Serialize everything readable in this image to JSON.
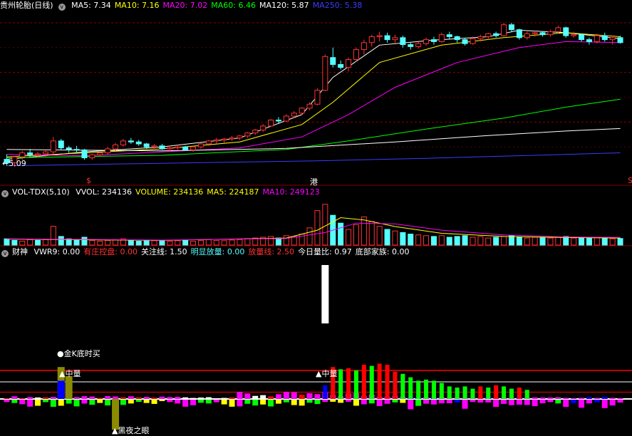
{
  "colors": {
    "ma5": "#ffffff",
    "ma10": "#ffff00",
    "ma20": "#ff00ff",
    "ma60": "#00ff00",
    "ma120": "#ffffff",
    "ma250": "#3b3bff",
    "up": "#ff3232",
    "down": "#54ffff",
    "red": "#ff0000",
    "green": "#00ff00",
    "magenta": "#ff00ff",
    "blue": "#0000ff",
    "olive": "#8b8b00",
    "white": "#ffffff"
  },
  "price_panel": {
    "title": "贵州轮胎(日线)",
    "indicators": [
      {
        "label": "MA5: 7.34",
        "color": "#ffffff"
      },
      {
        "label": "MA10: 7.16",
        "color": "#ffff00"
      },
      {
        "label": "MA20: 7.02",
        "color": "#ff00ff"
      },
      {
        "label": "MA60: 6.46",
        "color": "#00ff00"
      },
      {
        "label": "MA120: 5.87",
        "color": "#ffffff"
      },
      {
        "label": "MA250: 5.38",
        "color": "#3b3bff"
      }
    ],
    "low_label": "←5.09",
    "markers": [
      {
        "text": "$",
        "color": "#ff3232"
      },
      {
        "text": "港",
        "color": "#ffffff"
      },
      {
        "text": "S",
        "color": "#ff3232"
      }
    ]
  },
  "volume_panel": {
    "title": "VOL-TDX(5,10)",
    "indicators": [
      {
        "label": "VVOL: 234136",
        "color": "#ffffff"
      },
      {
        "label": "VOLUME: 234136",
        "color": "#ffff00"
      },
      {
        "label": "MA5: 224187",
        "color": "#ffff00"
      },
      {
        "label": "MA10: 249123",
        "color": "#ff00ff"
      }
    ]
  },
  "indicator_panel": {
    "title": "财神",
    "indicators": [
      {
        "label": "VWR9: 0.00",
        "color": "#ffffff"
      },
      {
        "label": "有庄控盘: 0.00",
        "color": "#ff3232"
      },
      {
        "label": "关注线: 1.50",
        "color": "#ffffff"
      },
      {
        "label": "明显放量: 0.00",
        "color": "#54ffff"
      },
      {
        "label": "放量线: 2.50",
        "color": "#ff3232"
      },
      {
        "label": "今日量比: 0.97",
        "color": "#ffffff"
      },
      {
        "label": "底部家族: 0.00",
        "color": "#ffffff"
      }
    ],
    "annotations": {
      "golden": "●金K底时买",
      "mid1": "▲中量",
      "mid2": "▲中量",
      "dark": "▲黑夜之眼"
    }
  },
  "chart_data": [
    {
      "type": "candlestick",
      "panel": "price",
      "y_range": [
        4.9,
        8.2
      ],
      "candles": [
        [
          5.25,
          5.35,
          5.12,
          5.18
        ],
        [
          5.18,
          5.32,
          5.1,
          5.3
        ],
        [
          5.3,
          5.42,
          5.24,
          5.38
        ],
        [
          5.38,
          5.46,
          5.3,
          5.34
        ],
        [
          5.34,
          5.4,
          5.28,
          5.36
        ],
        [
          5.36,
          5.44,
          5.3,
          5.4
        ],
        [
          5.4,
          5.7,
          5.36,
          5.62
        ],
        [
          5.62,
          5.66,
          5.44,
          5.48
        ],
        [
          5.48,
          5.52,
          5.38,
          5.45
        ],
        [
          5.45,
          5.52,
          5.38,
          5.44
        ],
        [
          5.44,
          5.46,
          5.24,
          5.28
        ],
        [
          5.28,
          5.36,
          5.24,
          5.34
        ],
        [
          5.34,
          5.4,
          5.3,
          5.38
        ],
        [
          5.38,
          5.5,
          5.35,
          5.46
        ],
        [
          5.46,
          5.58,
          5.42,
          5.54
        ],
        [
          5.54,
          5.66,
          5.5,
          5.62
        ],
        [
          5.62,
          5.68,
          5.56,
          5.6
        ],
        [
          5.6,
          5.64,
          5.52,
          5.56
        ],
        [
          5.56,
          5.58,
          5.46,
          5.5
        ],
        [
          5.5,
          5.56,
          5.44,
          5.52
        ],
        [
          5.52,
          5.56,
          5.44,
          5.46
        ],
        [
          5.46,
          5.52,
          5.4,
          5.48
        ],
        [
          5.48,
          5.54,
          5.44,
          5.5
        ],
        [
          5.5,
          5.52,
          5.42,
          5.44
        ],
        [
          5.44,
          5.52,
          5.4,
          5.5
        ],
        [
          5.5,
          5.58,
          5.46,
          5.56
        ],
        [
          5.56,
          5.64,
          5.52,
          5.62
        ],
        [
          5.62,
          5.68,
          5.56,
          5.64
        ],
        [
          5.64,
          5.68,
          5.58,
          5.66
        ],
        [
          5.66,
          5.72,
          5.62,
          5.68
        ],
        [
          5.68,
          5.74,
          5.64,
          5.72
        ],
        [
          5.72,
          5.8,
          5.68,
          5.78
        ],
        [
          5.78,
          5.86,
          5.74,
          5.84
        ],
        [
          5.84,
          5.96,
          5.8,
          5.92
        ],
        [
          5.92,
          6.06,
          5.9,
          6.04
        ],
        [
          6.04,
          6.1,
          5.96,
          6.02
        ],
        [
          6.02,
          6.16,
          6.0,
          6.12
        ],
        [
          6.12,
          6.22,
          6.08,
          6.18
        ],
        [
          6.18,
          6.3,
          6.14,
          6.28
        ],
        [
          6.28,
          6.4,
          6.24,
          6.36
        ],
        [
          6.36,
          6.68,
          6.34,
          6.64
        ],
        [
          6.64,
          7.36,
          6.62,
          7.32
        ],
        [
          7.3,
          7.5,
          7.1,
          7.16
        ],
        [
          7.16,
          7.24,
          7.06,
          7.1
        ],
        [
          7.1,
          7.3,
          7.02,
          7.26
        ],
        [
          7.26,
          7.5,
          7.22,
          7.46
        ],
        [
          7.46,
          7.66,
          7.36,
          7.6
        ],
        [
          7.6,
          7.76,
          7.52,
          7.72
        ],
        [
          7.72,
          7.82,
          7.62,
          7.74
        ],
        [
          7.74,
          7.8,
          7.6,
          7.66
        ],
        [
          7.66,
          7.76,
          7.58,
          7.7
        ],
        [
          7.7,
          7.74,
          7.5,
          7.56
        ],
        [
          7.56,
          7.6,
          7.46,
          7.52
        ],
        [
          7.52,
          7.62,
          7.48,
          7.58
        ],
        [
          7.58,
          7.7,
          7.54,
          7.66
        ],
        [
          7.66,
          7.72,
          7.56,
          7.62
        ],
        [
          7.62,
          7.8,
          7.6,
          7.76
        ],
        [
          7.76,
          7.82,
          7.66,
          7.72
        ],
        [
          7.72,
          7.74,
          7.6,
          7.66
        ],
        [
          7.66,
          7.7,
          7.54,
          7.58
        ],
        [
          7.58,
          7.72,
          7.56,
          7.68
        ],
        [
          7.68,
          7.76,
          7.62,
          7.72
        ],
        [
          7.72,
          7.8,
          7.66,
          7.78
        ],
        [
          7.78,
          7.82,
          7.7,
          7.74
        ],
        [
          7.74,
          8.0,
          7.72,
          7.96
        ],
        [
          7.96,
          8.0,
          7.82,
          7.86
        ],
        [
          7.86,
          7.88,
          7.66,
          7.7
        ],
        [
          7.7,
          7.82,
          7.66,
          7.78
        ],
        [
          7.78,
          7.84,
          7.72,
          7.8
        ],
        [
          7.8,
          7.82,
          7.72,
          7.76
        ],
        [
          7.76,
          7.86,
          7.72,
          7.82
        ],
        [
          7.82,
          7.94,
          7.78,
          7.9
        ],
        [
          7.9,
          7.92,
          7.7,
          7.74
        ],
        [
          7.74,
          7.82,
          7.7,
          7.76
        ],
        [
          7.76,
          7.78,
          7.62,
          7.66
        ],
        [
          7.66,
          7.7,
          7.56,
          7.62
        ],
        [
          7.62,
          7.78,
          7.58,
          7.74
        ],
        [
          7.74,
          7.8,
          7.62,
          7.66
        ],
        [
          7.66,
          7.74,
          7.56,
          7.7
        ],
        [
          7.7,
          7.74,
          7.58,
          7.6
        ]
      ],
      "ma": {
        "ma5": [
          [
            0,
            5.25
          ],
          [
            10,
            5.4
          ],
          [
            20,
            5.5
          ],
          [
            30,
            5.68
          ],
          [
            38,
            6.15
          ],
          [
            42,
            6.9
          ],
          [
            48,
            7.55
          ],
          [
            55,
            7.65
          ],
          [
            62,
            7.72
          ],
          [
            66,
            7.85
          ],
          [
            72,
            7.8
          ],
          [
            79,
            7.68
          ]
        ],
        "ma10": [
          [
            0,
            5.3
          ],
          [
            10,
            5.38
          ],
          [
            20,
            5.46
          ],
          [
            30,
            5.6
          ],
          [
            38,
            5.95
          ],
          [
            42,
            6.4
          ],
          [
            48,
            7.2
          ],
          [
            56,
            7.55
          ],
          [
            64,
            7.7
          ],
          [
            72,
            7.8
          ],
          [
            79,
            7.72
          ]
        ],
        "ma20": [
          [
            0,
            5.35
          ],
          [
            10,
            5.32
          ],
          [
            20,
            5.4
          ],
          [
            30,
            5.48
          ],
          [
            38,
            5.7
          ],
          [
            44,
            6.15
          ],
          [
            50,
            6.7
          ],
          [
            58,
            7.2
          ],
          [
            66,
            7.5
          ],
          [
            72,
            7.62
          ],
          [
            79,
            7.6
          ]
        ],
        "ma60": [
          [
            0,
            5.28
          ],
          [
            20,
            5.33
          ],
          [
            36,
            5.45
          ],
          [
            44,
            5.62
          ],
          [
            54,
            5.86
          ],
          [
            64,
            6.08
          ],
          [
            72,
            6.3
          ],
          [
            79,
            6.46
          ]
        ],
        "ma120": [
          [
            0,
            5.45
          ],
          [
            20,
            5.42
          ],
          [
            36,
            5.47
          ],
          [
            50,
            5.6
          ],
          [
            62,
            5.73
          ],
          [
            72,
            5.82
          ],
          [
            79,
            5.87
          ]
        ],
        "ma250": [
          [
            0,
            5.12
          ],
          [
            20,
            5.17
          ],
          [
            40,
            5.22
          ],
          [
            54,
            5.27
          ],
          [
            68,
            5.33
          ],
          [
            79,
            5.38
          ]
        ]
      }
    },
    {
      "type": "bar",
      "panel": "volume",
      "y_range": [
        0,
        300000
      ],
      "values": [
        40,
        30,
        25,
        35,
        30,
        35,
        120,
        55,
        40,
        35,
        50,
        30,
        25,
        30,
        35,
        40,
        30,
        25,
        30,
        28,
        30,
        25,
        28,
        30,
        25,
        30,
        35,
        30,
        28,
        32,
        35,
        40,
        45,
        50,
        55,
        45,
        60,
        55,
        70,
        110,
        220,
        260,
        190,
        140,
        100,
        130,
        180,
        150,
        120,
        100,
        90,
        80,
        70,
        65,
        60,
        55,
        60,
        50,
        55,
        60,
        50,
        55,
        45,
        50,
        55,
        60,
        50,
        45,
        50,
        48,
        45,
        50,
        55,
        45,
        50,
        45,
        50,
        45,
        40,
        42
      ],
      "up": [
        0,
        0,
        1,
        1,
        0,
        1,
        1,
        0,
        0,
        0,
        0,
        1,
        1,
        1,
        1,
        1,
        0,
        0,
        0,
        1,
        0,
        1,
        1,
        0,
        1,
        1,
        1,
        1,
        1,
        1,
        1,
        1,
        1,
        1,
        1,
        0,
        1,
        1,
        1,
        1,
        1,
        1,
        0,
        0,
        1,
        1,
        1,
        1,
        1,
        0,
        1,
        0,
        0,
        1,
        1,
        0,
        1,
        0,
        0,
        0,
        1,
        1,
        1,
        0,
        1,
        0,
        0,
        1,
        1,
        0,
        1,
        1,
        0,
        1,
        0,
        0,
        1,
        0,
        1,
        0
      ],
      "ma5": [
        [
          0,
          38
        ],
        [
          20,
          30
        ],
        [
          36,
          45
        ],
        [
          40,
          95
        ],
        [
          43,
          175
        ],
        [
          46,
          160
        ],
        [
          50,
          118
        ],
        [
          56,
          75
        ],
        [
          64,
          55
        ],
        [
          72,
          48
        ],
        [
          79,
          45
        ]
      ],
      "ma10": [
        [
          0,
          40
        ],
        [
          20,
          32
        ],
        [
          36,
          42
        ],
        [
          41,
          80
        ],
        [
          45,
          140
        ],
        [
          50,
          135
        ],
        [
          56,
          95
        ],
        [
          64,
          65
        ],
        [
          72,
          52
        ],
        [
          79,
          49
        ]
      ]
    },
    {
      "type": "bar",
      "panel": "indicator",
      "y_range": [
        -4,
        5
      ],
      "reference_lines": [
        1.5,
        2.5
      ],
      "white_spike_index": 41,
      "top_bars": [
        [
          41,
          1.2,
          "#0000ff"
        ],
        [
          42,
          2.8,
          "#ff0000"
        ],
        [
          43,
          2.6,
          "#00ff00"
        ],
        [
          44,
          2.7,
          "#ff0000"
        ],
        [
          45,
          2.5,
          "#00ff00"
        ],
        [
          46,
          3.0,
          "#ff0000"
        ],
        [
          47,
          2.9,
          "#00ff00"
        ],
        [
          48,
          3.1,
          "#ff0000"
        ],
        [
          49,
          3.0,
          "#ff0000"
        ],
        [
          50,
          2.4,
          "#ff0000"
        ],
        [
          51,
          2.2,
          "#00ff00"
        ],
        [
          52,
          1.9,
          "#00ff00"
        ],
        [
          53,
          1.6,
          "#00ff00"
        ],
        [
          54,
          1.7,
          "#00ff00"
        ],
        [
          55,
          1.6,
          "#00ff00"
        ],
        [
          56,
          1.4,
          "#00ff00"
        ],
        [
          57,
          1.1,
          "#00ff00"
        ],
        [
          58,
          1.0,
          "#00ff00"
        ],
        [
          59,
          1.1,
          "#00ff00"
        ],
        [
          60,
          0.9,
          "#00ff00"
        ],
        [
          61,
          1.1,
          "#ff0000"
        ],
        [
          62,
          1.0,
          "#00ff00"
        ],
        [
          63,
          1.2,
          "#ff0000"
        ],
        [
          64,
          1.1,
          "#00ff00"
        ],
        [
          65,
          0.9,
          "#00ff00"
        ],
        [
          66,
          1.0,
          "#ff0000"
        ],
        [
          67,
          0.8,
          "#00ff00"
        ]
      ],
      "lead_bars": [
        [
          7,
          2.8,
          "#8b8b00"
        ],
        [
          7,
          1.6,
          "#0000ff"
        ],
        [
          8,
          2.0,
          "#8b8b00"
        ],
        [
          14,
          -2.7,
          "#8b8b00"
        ]
      ]
    }
  ]
}
